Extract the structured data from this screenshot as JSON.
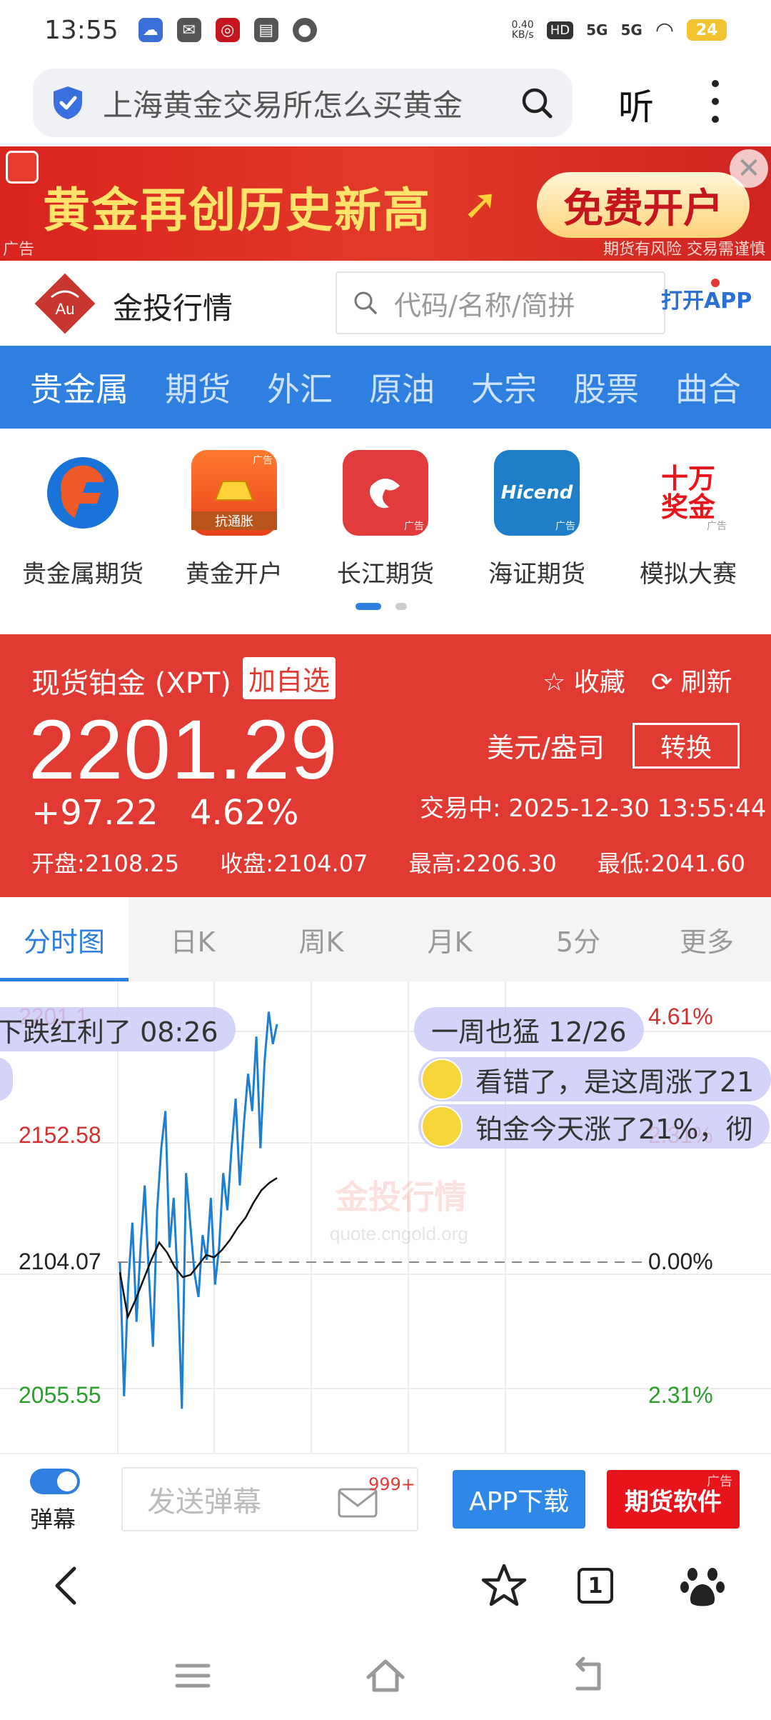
{
  "status_bar": {
    "time": "13:55",
    "net_speed_value": "0.40",
    "net_speed_unit": "KB/s",
    "hd_label": "HD",
    "signal1": "5G",
    "signal2": "5G",
    "battery": "24"
  },
  "browser_search": {
    "query": "上海黄金交易所怎么买黄金",
    "listen_label": "听"
  },
  "ad_banner": {
    "headline": "黄金再创历史新高",
    "cta": "免费开户",
    "ad_tag": "广告",
    "risk_notice": "期货有风险 交易需谨慎"
  },
  "site_header": {
    "site_name": "金投行情",
    "logo_text": "Au",
    "search_placeholder": "代码/名称/简拼",
    "open_app": "打开APP"
  },
  "category_nav": [
    {
      "label": "贵金属",
      "active": true
    },
    {
      "label": "期货",
      "active": false
    },
    {
      "label": "外汇",
      "active": false
    },
    {
      "label": "原油",
      "active": false
    },
    {
      "label": "大宗",
      "active": false
    },
    {
      "label": "股票",
      "active": false
    },
    {
      "label": "曲合",
      "active": false
    }
  ],
  "shortcuts": [
    {
      "label": "贵金属期货",
      "icon": "precious-metal-futures-icon",
      "color": "#e8f0fb",
      "ad": "广告"
    },
    {
      "label": "黄金开户",
      "icon": "gold-bar-icon",
      "color": "#f05a28",
      "sub": "抗通胀",
      "ad": "广告"
    },
    {
      "label": "长江期货",
      "icon": "dragon-icon",
      "color": "#e23b3b",
      "ad": "广告"
    },
    {
      "label": "海证期货",
      "icon": "hicend-icon",
      "color": "#1f7ec8",
      "brand": "Hicend",
      "ad": "广告"
    },
    {
      "label": "模拟大赛",
      "icon": "prize-icon",
      "color": "#ffffff",
      "brand": "十万奖金",
      "ad": "广告"
    }
  ],
  "quote": {
    "name": "现货铂金 (XPT)",
    "add_watch": "加自选",
    "collect": "收藏",
    "refresh": "刷新",
    "price": "2201.29",
    "unit": "美元/盎司",
    "switch": "转换",
    "change": "+97.22",
    "change_pct": "4.62%",
    "trading_status": "交易中: 2025-12-30 13:55:44",
    "open": "开盘:2108.25",
    "close": "收盘:2104.07",
    "high": "最高:2206.30",
    "low": "最低:2041.60"
  },
  "chart_tabs": [
    {
      "label": "分时图",
      "active": true
    },
    {
      "label": "日K",
      "active": false
    },
    {
      "label": "周K",
      "active": false
    },
    {
      "label": "月K",
      "active": false
    },
    {
      "label": "5分",
      "active": false
    },
    {
      "label": "更多",
      "active": false
    }
  ],
  "chart_data": {
    "type": "line",
    "y_labels_left": [
      "2201.1",
      "2152.58",
      "2104.07",
      "2055.55"
    ],
    "y_labels_right": [
      "4.61%",
      "2.31%",
      "0.00%",
      "2.31%"
    ],
    "reference_value": 2104.07,
    "ylim": [
      2041.6,
      2206.3
    ],
    "watermark": "金投行情",
    "watermark_url": "quote.cngold.org",
    "series": [
      {
        "values": [
          2104,
          2050,
          2095,
          2120,
          2080,
          2110,
          2135,
          2099,
          2070,
          2125,
          2150,
          2165,
          2110,
          2130,
          2095,
          2045,
          2140,
          2120,
          2100,
          2090,
          2115,
          2105,
          2130,
          2095,
          2110,
          2140,
          2125,
          2150,
          2170,
          2135,
          2160,
          2180,
          2165,
          2195,
          2150,
          2185,
          2205,
          2192,
          2200
        ]
      },
      {
        "values": [
          2100,
          2082,
          2089,
          2097,
          2105,
          2112,
          2108,
          2102,
          2098,
          2099,
          2103,
          2107,
          2106,
          2109,
          2113,
          2118,
          2122,
          2128,
          2133,
          2136,
          2138
        ]
      }
    ]
  },
  "danmu": [
    {
      "text": "下跌红利了 08:26"
    },
    {
      "text": "一周也猛 12/26"
    },
    {
      "text": "看错了，是这周涨了21"
    },
    {
      "text": "铂金今天涨了21%，彻"
    }
  ],
  "action_bar": {
    "danmu_toggle": "弹幕",
    "send_placeholder": "发送弹幕",
    "badge": "999+",
    "app_download": "APP下载",
    "futures_software": "期货软件",
    "ad_tag": "广告"
  },
  "browser_nav": {
    "tab_count": "1"
  }
}
